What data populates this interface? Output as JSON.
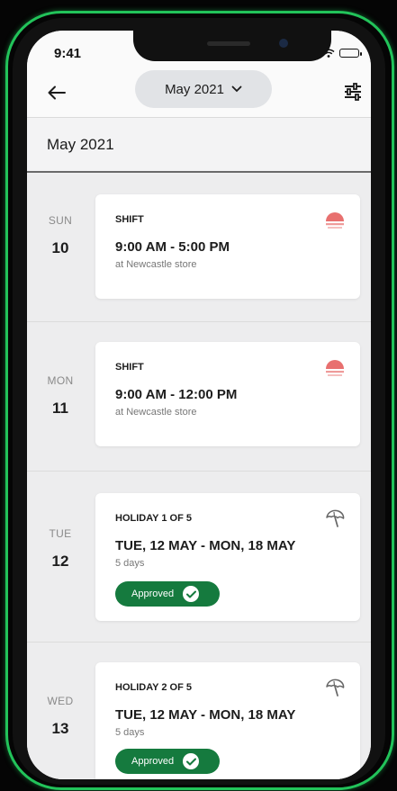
{
  "status_bar": {
    "time": "9:41"
  },
  "header": {
    "month_label": "May 2021"
  },
  "month_header": {
    "label": "May 2021"
  },
  "days": [
    {
      "day_name": "SUN",
      "day_number": "10",
      "card": {
        "type": "SHIFT",
        "time": "9:00 AM - 5:00 PM",
        "subtitle": "at Newcastle store",
        "icon": "sunset-icon"
      }
    },
    {
      "day_name": "MON",
      "day_number": "11",
      "card": {
        "type": "SHIFT",
        "time": "9:00 AM - 12:00 PM",
        "subtitle": "at Newcastle store",
        "icon": "sunset-icon"
      }
    },
    {
      "day_name": "TUE",
      "day_number": "12",
      "card": {
        "type": "HOLIDAY 1 OF 5",
        "time": "TUE, 12 MAY - MON, 18 MAY",
        "subtitle": "5 days",
        "status": "Approved",
        "icon": "beach-umbrella-icon"
      }
    },
    {
      "day_name": "WED",
      "day_number": "13",
      "card": {
        "type": "HOLIDAY 2 OF 5",
        "time": "TUE, 12 MAY - MON, 18 MAY",
        "subtitle": "5 days",
        "status": "Approved",
        "icon": "beach-umbrella-icon"
      }
    }
  ],
  "colors": {
    "accent_green": "#157a3e",
    "frame_glow": "#22c35a",
    "shift_icon": "#e8706f"
  }
}
